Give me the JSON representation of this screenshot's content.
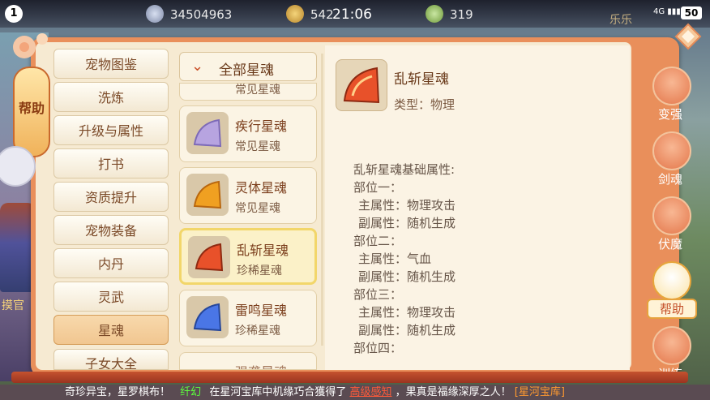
{
  "status": {
    "indicator": "1",
    "currency1": "34504963",
    "currency2": "542",
    "clock": "21:06",
    "currency3": "319",
    "faded_text": "乐乐",
    "signal": "4G",
    "battery": "50"
  },
  "left_help_tab": "帮助",
  "categories": [
    "宠物图鉴",
    "洗炼",
    "升级与属性",
    "打书",
    "资质提升",
    "宠物装备",
    "内丹",
    "灵武",
    "星魂",
    "子女大全"
  ],
  "selected_category": "星魂",
  "filter": {
    "label": "全部星魂"
  },
  "list": {
    "clipped_top_rarity": "常见星魂",
    "items": [
      {
        "name": "疾行星魂",
        "rarity": "常见星魂",
        "icon": "star-soul-purple-icon",
        "color": "#b7a4e0"
      },
      {
        "name": "灵体星魂",
        "rarity": "常见星魂",
        "icon": "star-soul-orange-icon",
        "color": "#f0a021"
      },
      {
        "name": "乱斩星魂",
        "rarity": "珍稀星魂",
        "icon": "star-soul-red-icon",
        "color": "#e8512a"
      },
      {
        "name": "雷鸣星魂",
        "rarity": "珍稀星魂",
        "icon": "star-soul-blue-icon",
        "color": "#4a76e6"
      }
    ],
    "clipped_bottom_name": "强袭星魂",
    "selected": "乱斩星魂"
  },
  "detail": {
    "name": "乱斩星魂",
    "type": "类型：物理",
    "heading": "乱斩星魂基础属性:",
    "lines": [
      "部位一：",
      "主属性：物理攻击",
      "副属性：随机生成",
      "部位二：",
      "主属性：气血",
      "副属性：随机生成",
      "部位三：",
      "主属性：物理攻击",
      "副属性：随机生成",
      "部位四："
    ]
  },
  "right_tabs": [
    {
      "label": "变强",
      "icon": "strength-icon"
    },
    {
      "label": "剑魂",
      "icon": "sword-icon"
    },
    {
      "label": "伏魔",
      "icon": "demon-icon"
    },
    {
      "label": "帮助",
      "icon": "help-clown-icon"
    },
    {
      "label": "训练",
      "icon": "book-icon"
    }
  ],
  "selected_right_tab": "帮助",
  "background_name": "摸官",
  "ticker": {
    "part1": "奇珍异宝，星罗棋布！",
    "player": "纤幻",
    "part2": "在星河宝库中机缘巧合獲得了",
    "item": "高级感知",
    "part3": "，果真是福缘深厚之人！",
    "link": "[星河宝库]"
  },
  "colors": {
    "accent": "#e98f5b",
    "highlight": "#f2d66a",
    "player": "#5dff3d",
    "item": "#ff5a3a",
    "link": "#ff9a30"
  }
}
